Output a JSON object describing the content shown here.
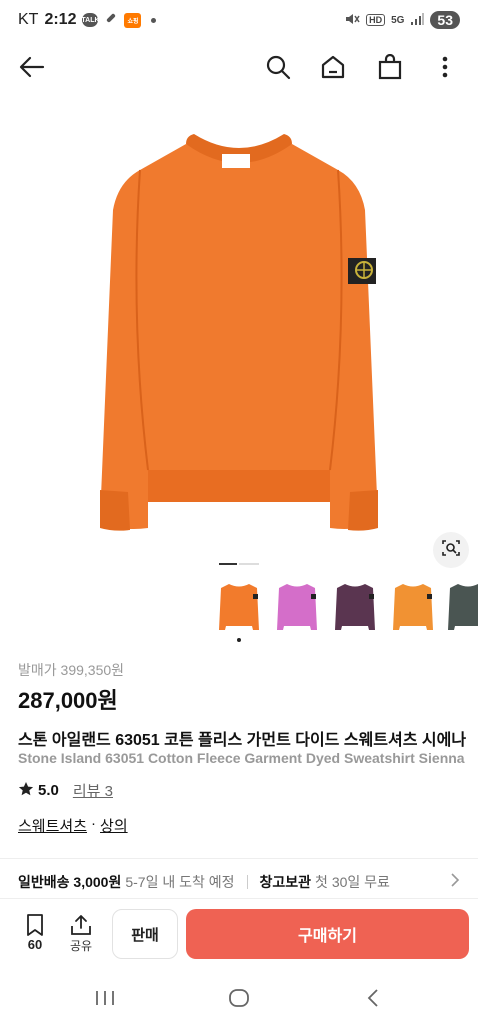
{
  "status_bar": {
    "carrier": "KT",
    "time": "2:12",
    "talk_badge": "TALK",
    "app_badge": "쇼핑",
    "network": "5G",
    "hd": "HD",
    "battery": "53"
  },
  "nav": {
    "icons": [
      "back-arrow-icon",
      "search-icon",
      "home-icon",
      "shopping-bag-icon",
      "more-vert-icon"
    ]
  },
  "product": {
    "original_price": "발매가 399,350원",
    "price": "287,000원",
    "title_kr": "스톤 아일랜드 63051 코튼 플리스 가먼트 다이드 스웨트셔츠 시에나",
    "title_en": "Stone Island 63051 Cotton Fleece Garment Dyed Sweatshirt Sienna",
    "rating": "5.0",
    "reviews": "리뷰 3",
    "category_main": "스웨트셔츠",
    "category_sep": "·",
    "category_sub": "상의",
    "colors": {
      "hero": "#f07a2e",
      "hero_shadow": "#e26a1f",
      "thumbs": [
        "#f27b2c",
        "#d46ec9",
        "#5a3550",
        "#f19233",
        "#4a5552"
      ]
    }
  },
  "shipping": {
    "label": "일반배송 3,000원",
    "eta": "5-7일 내 도착 예정",
    "storage_label": "창고보관",
    "storage_note": "첫 30일 무료"
  },
  "bottom": {
    "bookmark_count": "60",
    "share_label": "공유",
    "sell_label": "판매",
    "buy_label": "구매하기",
    "buy_color": "#ef6253"
  }
}
